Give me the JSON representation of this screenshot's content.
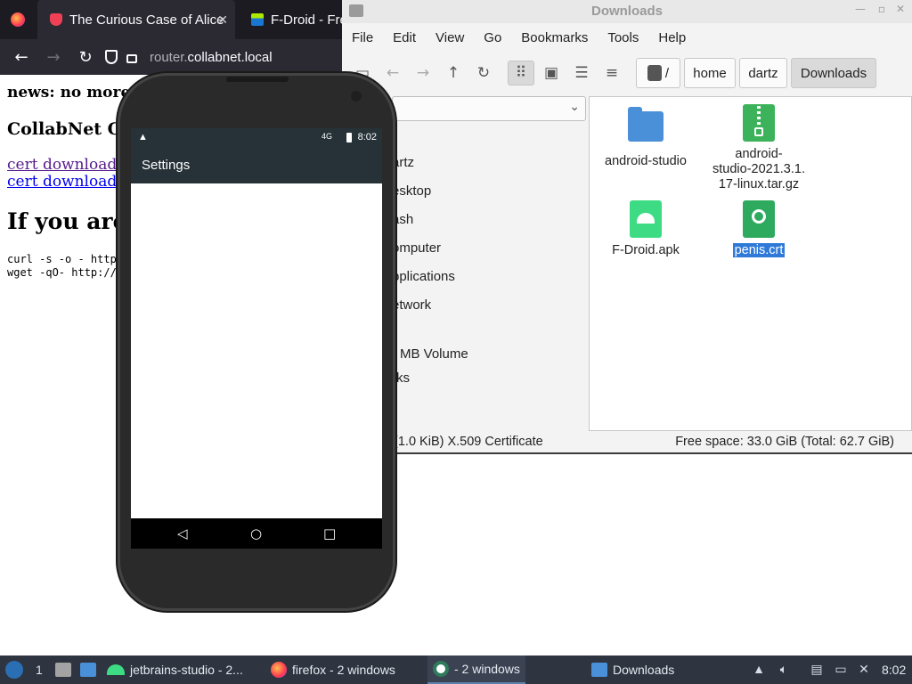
{
  "browser": {
    "tabs": [
      {
        "label": "The Curious Case of Alice"
      },
      {
        "label": "F-Droid - Fre"
      }
    ],
    "url": {
      "host_prefix": "router.",
      "host_main": "collabnet.local"
    },
    "content": {
      "news": "news: no more",
      "heading": "CollabNet C",
      "cert_link_1": "cert download (",
      "cert_link_2": "cert download (",
      "big_heading": "If you are",
      "cmd_1": "curl -s -o - http",
      "cmd_2": "wget -qO- http://"
    }
  },
  "file_manager": {
    "title": "Downloads",
    "menu": [
      "File",
      "Edit",
      "View",
      "Go",
      "Bookmarks",
      "Tools",
      "Help"
    ],
    "breadcrumb": {
      "root": "/",
      "items": [
        "home",
        "dartz",
        "Downloads"
      ]
    },
    "sidebar": [
      "artz",
      "esktop",
      "ash",
      "omputer",
      "pplications",
      "etwork",
      "MB Volume",
      "rks"
    ],
    "files": [
      {
        "name": "android-studio",
        "type": "folder"
      },
      {
        "name": "android-studio-2021.3.1.17-linux.tar.gz",
        "line1": "android-",
        "line2": "studio-2021.3.1.",
        "line3": "17-linux.tar.gz",
        "type": "archive"
      },
      {
        "name": "F-Droid.apk",
        "type": "apk"
      },
      {
        "name": "penis.crt",
        "type": "certificate",
        "selected": true
      }
    ],
    "status_left": "rt\" (1.0 KiB) X.509 Certificate",
    "status_right": "Free space: 33.0 GiB (Total: 62.7 GiB)"
  },
  "emulator": {
    "status_time": "8:02",
    "status_signal": "4G",
    "app_title": "Settings"
  },
  "taskbar": {
    "workspace": "1",
    "tasks": [
      {
        "label": "jetbrains-studio - 2..."
      },
      {
        "label": "firefox - 2 windows"
      },
      {
        "label": "- 2 windows"
      },
      {
        "label": "Downloads"
      }
    ],
    "clock": "8:02"
  }
}
